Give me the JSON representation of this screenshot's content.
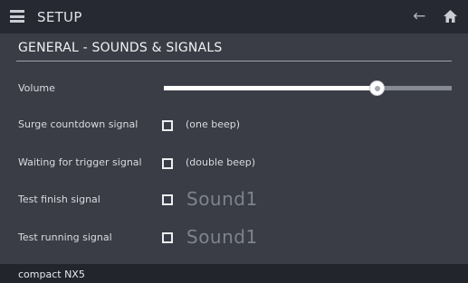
{
  "header": {
    "title": "SETUP",
    "menu_icon": "menu-icon",
    "back_icon": "arrow-left-icon",
    "home_icon": "home-icon"
  },
  "section": {
    "title": "GENERAL - SOUNDS & SIGNALS"
  },
  "settings": {
    "volume": {
      "label": "Volume",
      "level": 0.74
    },
    "surge_countdown": {
      "label": "Surge countdown signal",
      "checked": false,
      "hint": "(one beep)"
    },
    "waiting_trigger": {
      "label": "Waiting for trigger signal",
      "checked": false,
      "hint": "(double beep)"
    },
    "test_finish": {
      "label": "Test finish signal",
      "checked": false,
      "sound": "Sound1"
    },
    "test_running": {
      "label": "Test running signal",
      "checked": false,
      "sound": "Sound1"
    }
  },
  "footer": {
    "device": "compact NX5"
  },
  "colors": {
    "background": "#3a3d45",
    "titlebar": "#262931",
    "footer": "#22252c",
    "slider_fill": "#ffffff",
    "slider_track": "#868a92",
    "disabled_text": "#7f838b"
  }
}
